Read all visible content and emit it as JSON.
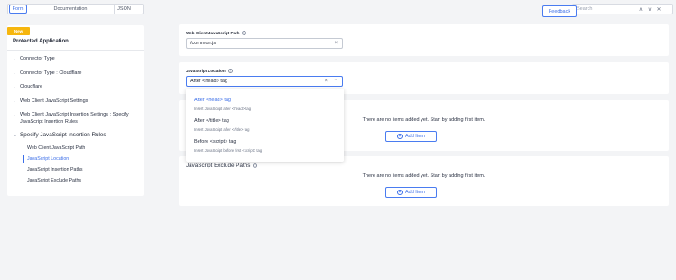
{
  "topbar": {
    "tabs": [
      "Form",
      "Documentation",
      "JSON"
    ],
    "feedback_label": "Feedback",
    "search_placeholder": "Search",
    "up_glyph": "∧",
    "down_glyph": "∨",
    "close_glyph": "✕"
  },
  "sidebar": {
    "badge": "New",
    "title": "Protected Application",
    "items": [
      "Connector Type",
      "Connector Type : Cloudflare",
      "Cloudflare",
      "Web Client JavaScript Settings",
      "Web Client JavaScript Insertion Settings : Specify",
      "JavaScript Insertion Rules",
      "Specify JavaScript Insertion Rules"
    ],
    "subitems": [
      "Web Client JavaScript Path",
      "JavaScript Location",
      "JavaScript Insertion Paths",
      "JavaScript Exclude Paths"
    ],
    "active_subitem": "JavaScript Location"
  },
  "form": {
    "js_path": {
      "label": "Web Client JavaScript Path",
      "value": "/common.js"
    },
    "js_location": {
      "label": "JavaScript Location",
      "value": "After <head> tag",
      "options": [
        {
          "label": "After <head> tag",
          "description": "Insert JavaScript after <head> tag"
        },
        {
          "label": "After </title> tag",
          "description": "Insert JavaScript after </title> tag"
        },
        {
          "label": "Before <script> tag",
          "description": "Insert JavaScript before first <script> tag"
        }
      ]
    },
    "insertion_paths": {
      "empty_message": "There are no items added yet. Start by adding first item.",
      "add_label": "Add Item"
    },
    "exclude_paths": {
      "title": "JavaScript Exclude Paths",
      "empty_message": "There are no items added yet. Start by adding first item.",
      "add_label": "Add Item"
    }
  },
  "colors": {
    "accent": "#3b6ee8",
    "badge": "#f6b60e",
    "background": "#f3f4f6"
  }
}
